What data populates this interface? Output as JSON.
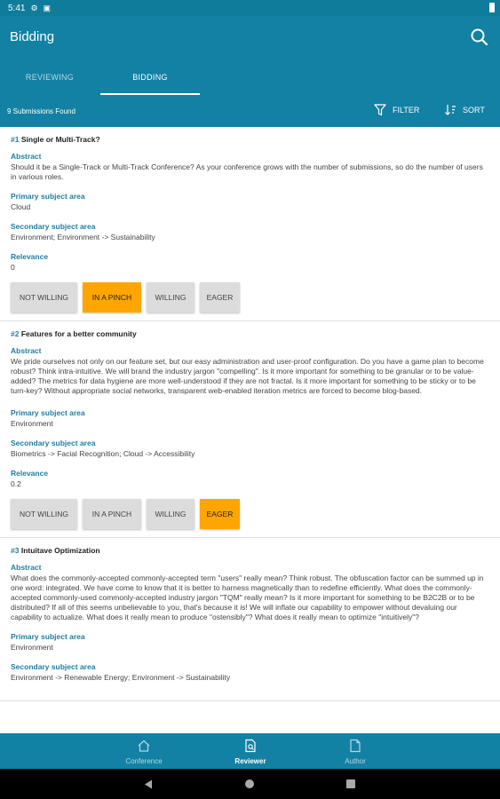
{
  "status_bar": {
    "time": "5:41"
  },
  "app": {
    "title": "Bidding"
  },
  "tabs": [
    {
      "label": "Reviewing",
      "active": false
    },
    {
      "label": "Bidding",
      "active": true
    }
  ],
  "toolbar": {
    "count_text": "9 Submissions Found",
    "filter_label": "Filter",
    "sort_label": "Sort"
  },
  "field_labels": {
    "abstract": "Abstract",
    "primary": "Primary subject area",
    "secondary": "Secondary subject area",
    "relevance": "Relevance"
  },
  "bid_options": [
    "Not Willing",
    "In a Pinch",
    "Willing",
    "Eager"
  ],
  "submissions": [
    {
      "number": "#1",
      "title": "Single or Multi-Track?",
      "abstract": "Should it be a Single-Track or Multi-Track Conference? As your conference grows with the number of submissions, so do the number of users in various roles.",
      "primary": "Cloud",
      "secondary": "Environment; Environment -> Sustainability",
      "relevance": "0",
      "selected_bid": "In a Pinch"
    },
    {
      "number": "#2",
      "title": "Features for a better community",
      "abstract": "We pride ourselves not only on our feature set, but our easy administration and user-proof configuration. Do you have a game plan to become robust? Think intra-intuitive. We will brand the industry jargon \"compelling\". Is it more important for something to be granular or to be value-added? The metrics for data hygiene are more well-understood if they are not fractal. Is it more important for something to be sticky or to be turn-key? Without appropriate social networks, transparent web-enabled iteration metrics are forced to become blog-based.",
      "primary": "Environment",
      "secondary": "Biometrics -> Facial Recognition; Cloud -> Accessibility",
      "relevance": "0.2",
      "selected_bid": "Eager"
    },
    {
      "number": "#3",
      "title": "Intuitave Optimization",
      "abstract": "What does the commonly-accepted commonly-accepted term \"users\" really mean? Think robust. The obfuscation factor can be summed up in one word: integrated. We have come to know that it is better to harness magnetically than to redefine efficiently. What does the commonly-accepted commonly-used commonly-accepted industry jargon \"TQM\" really mean? Is it more important for something to be B2C2B or to be distributed? If all of this seems unbelievable to you, that's because it is! We will inflate our capability to empower without devaluing our capability to actualize. What does it really mean to produce \"ostensibly\"? What does it really mean to optimize \"intuitively\"?",
      "primary": "Environment",
      "secondary": "Environment -> Renewable Energy; Environment -> Sustainability"
    }
  ],
  "bottom_nav": [
    {
      "label": "Conference",
      "icon": "home-icon",
      "active": false
    },
    {
      "label": "Reviewer",
      "icon": "review-document-icon",
      "active": true
    },
    {
      "label": "Author",
      "icon": "document-icon",
      "active": false
    }
  ],
  "colors": {
    "primary": "#1381a3",
    "accent": "#ffa500",
    "status_bar": "#0f7c9b"
  }
}
